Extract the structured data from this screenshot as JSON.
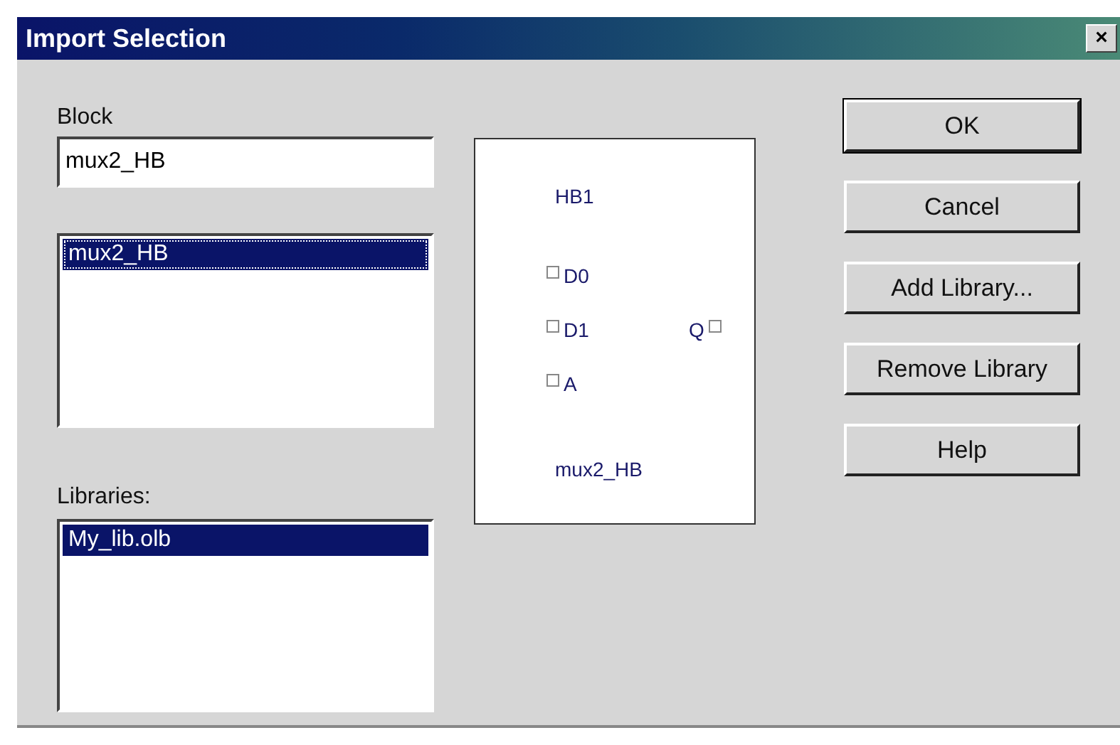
{
  "window": {
    "title": "Import Selection",
    "close": "×"
  },
  "block": {
    "label": "Block",
    "value": "mux2_HB",
    "items": [
      {
        "label": "mux2_HB",
        "selected": true
      }
    ]
  },
  "libraries": {
    "label": "Libraries:",
    "items": [
      {
        "label": "My_lib.olb",
        "selected": true
      }
    ]
  },
  "preview": {
    "instance": "HB1",
    "part_name": "mux2_HB",
    "left_pins": [
      "D0",
      "D1",
      "A"
    ],
    "right_pins": [
      "Q"
    ]
  },
  "buttons": [
    {
      "label": "OK",
      "default": true
    },
    {
      "label": "Cancel",
      "default": false
    },
    {
      "label": "Add Library...",
      "default": false
    },
    {
      "label": "Remove Library",
      "default": false
    },
    {
      "label": "Help",
      "default": false
    }
  ]
}
